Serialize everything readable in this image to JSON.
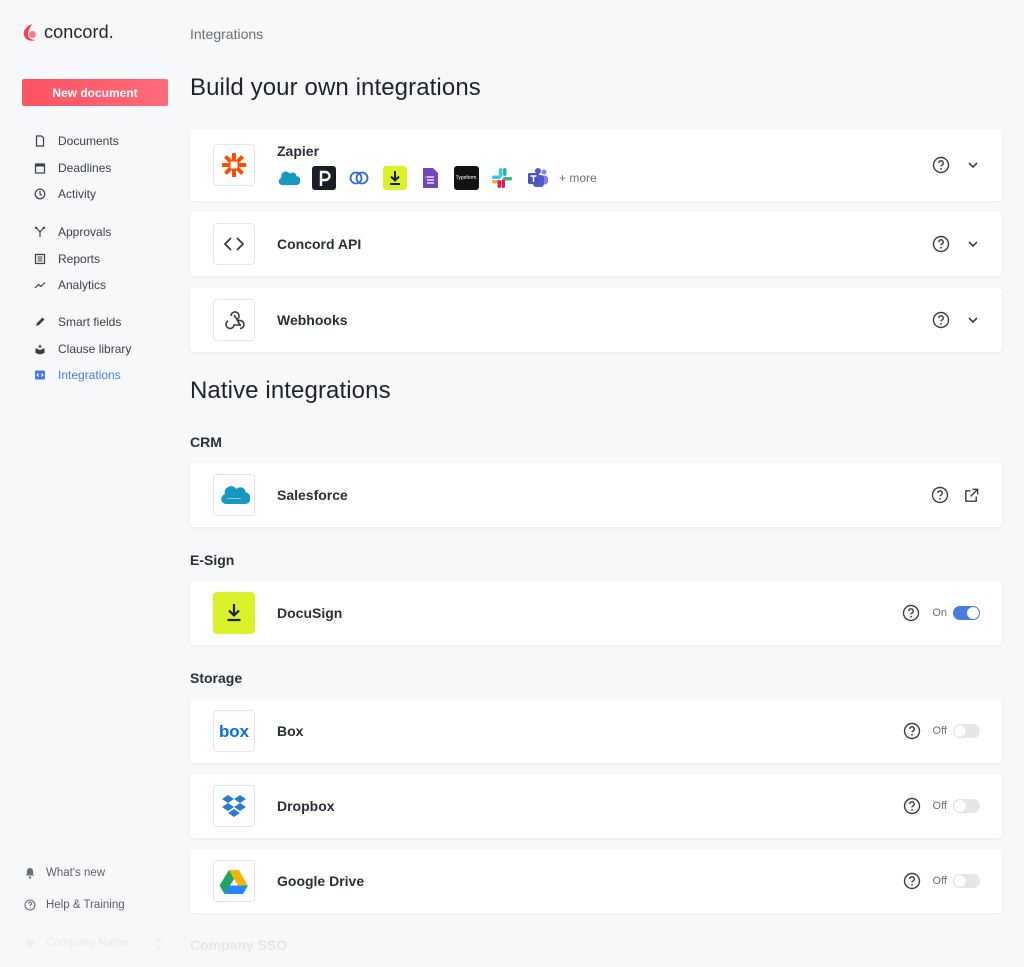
{
  "brand": {
    "name": "concord",
    "accent": "#ff5363",
    "link": "#4a7cdf"
  },
  "sidebar": {
    "new_document": "New document",
    "groups": [
      [
        {
          "label": "Documents",
          "icon": "document-icon"
        },
        {
          "label": "Deadlines",
          "icon": "calendar-icon"
        },
        {
          "label": "Activity",
          "icon": "clock-icon"
        }
      ],
      [
        {
          "label": "Approvals",
          "icon": "fork-icon"
        },
        {
          "label": "Reports",
          "icon": "reports-icon"
        },
        {
          "label": "Analytics",
          "icon": "trend-icon"
        }
      ],
      [
        {
          "label": "Smart fields",
          "icon": "pen-icon"
        },
        {
          "label": "Clause library",
          "icon": "library-icon"
        },
        {
          "label": "Integrations",
          "icon": "integrations-icon"
        }
      ]
    ],
    "active": "Integrations",
    "bottom": {
      "whats_new": "What's new",
      "help": "Help & Training",
      "company": "Company Name"
    }
  },
  "main": {
    "breadcrumb": "Integrations",
    "build_title": "Build your own integrations",
    "native_title": "Native integrations",
    "zapier": {
      "name": "Zapier",
      "more": "+ more"
    },
    "concord_api": {
      "name": "Concord API"
    },
    "webhooks": {
      "name": "Webhooks"
    },
    "crm": {
      "title": "CRM",
      "salesforce": "Salesforce"
    },
    "esign": {
      "title": "E-Sign",
      "docusign": "DocuSign",
      "state": "On"
    },
    "storage": {
      "title": "Storage",
      "box": {
        "name": "Box",
        "state": "Off"
      },
      "dropbox": {
        "name": "Dropbox",
        "state": "Off"
      },
      "gdrive": {
        "name": "Google Drive",
        "state": "Off"
      }
    },
    "sso_title": "Company SSO"
  }
}
